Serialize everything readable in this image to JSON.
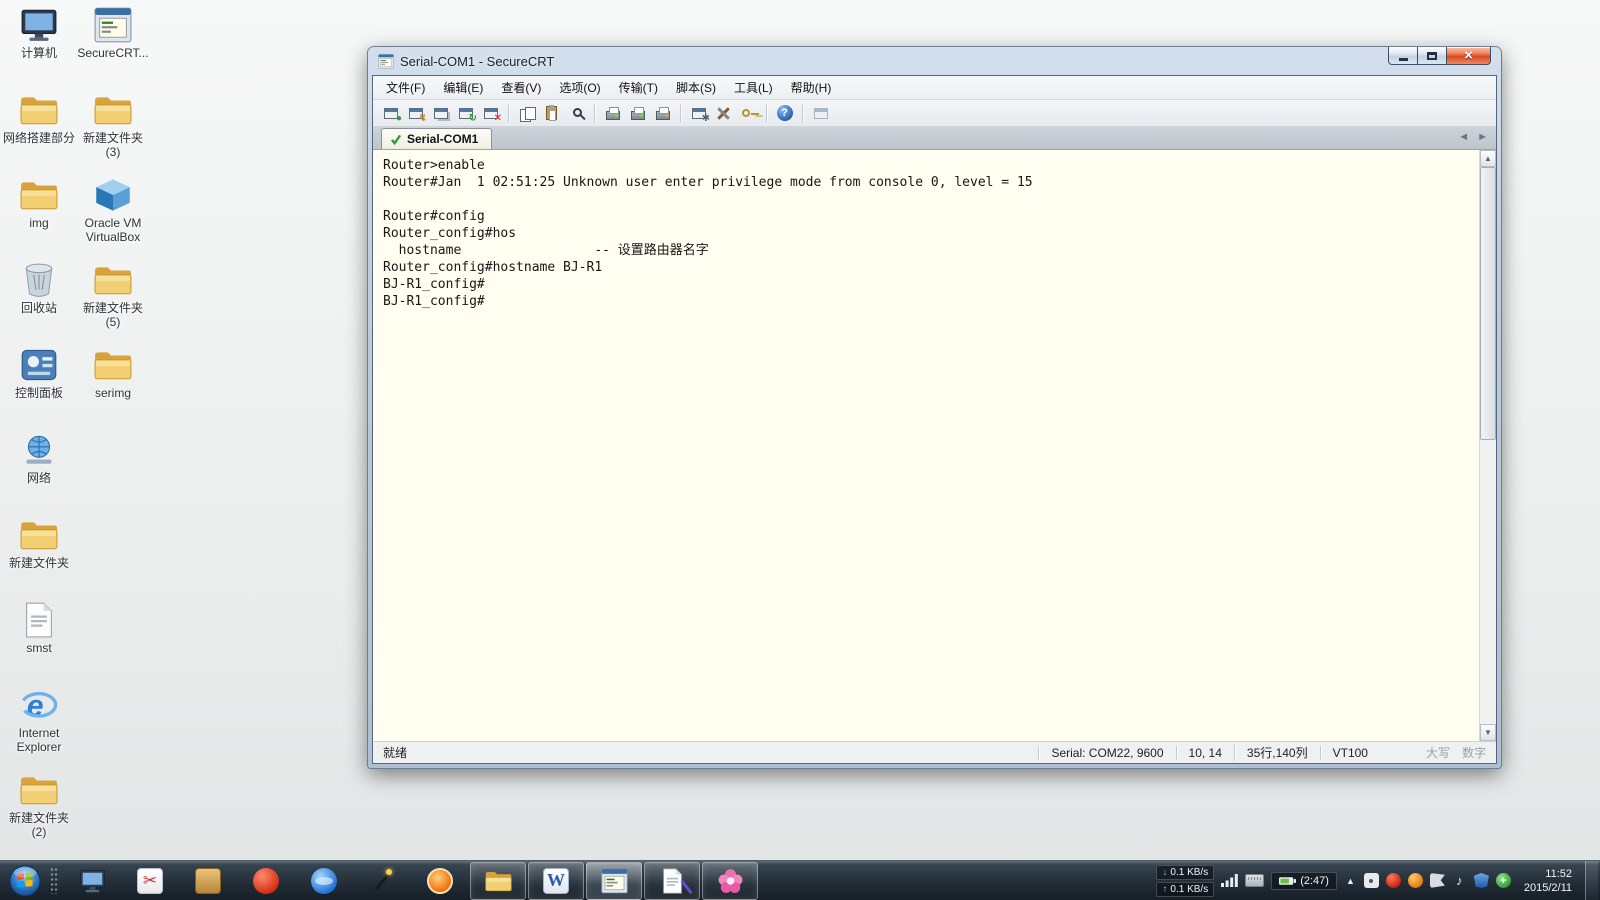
{
  "desktop": {
    "icons": [
      {
        "label": "计算机"
      },
      {
        "label": "网络搭建部分"
      },
      {
        "label": "img"
      },
      {
        "label": "回收站"
      },
      {
        "label": "控制面板"
      },
      {
        "label": "网络"
      },
      {
        "label": "新建文件夹"
      },
      {
        "label": "smst"
      },
      {
        "label": "Internet Explorer"
      },
      {
        "label": "新建文件夹 (2)"
      },
      {
        "label": "SecureCRT..."
      },
      {
        "label": "新建文件夹 (3)"
      },
      {
        "label": "Oracle VM VirtualBox"
      },
      {
        "label": "新建文件夹 (5)"
      },
      {
        "label": "serimg"
      }
    ]
  },
  "window": {
    "title": "Serial-COM1 - SecureCRT",
    "menus": [
      "文件(F)",
      "编辑(E)",
      "查看(V)",
      "选项(O)",
      "传输(T)",
      "脚本(S)",
      "工具(L)",
      "帮助(H)"
    ],
    "tab": {
      "label": "Serial-COM1"
    },
    "terminal": {
      "lines": [
        "Router>enable",
        "Router#Jan  1 02:51:25 Unknown user enter privilege mode from console 0, level = 15",
        "",
        "Router#config",
        "Router_config#hos",
        "  hostname                 -- 设置路由器名字",
        "Router_config#hostname BJ-R1",
        "BJ-R1_config#",
        "BJ-R1_config#"
      ]
    },
    "status": {
      "ready": "就绪",
      "serial": "Serial: COM22, 9600",
      "cursor": "10, 14",
      "size": "35行,140列",
      "emulation": "VT100",
      "caps": "大写",
      "num": "数字"
    }
  },
  "taskbar": {
    "tray": {
      "net_down": "0.1 KB/s",
      "net_up": "0.1 KB/s",
      "battery": "(2:47)",
      "time": "11:52",
      "date": "2015/2/11"
    }
  },
  "colors": {
    "terminal_bg": "#fffef0",
    "title_glass": "#c5d3e2",
    "close_red": "#d6481f",
    "taskbar_dark": "#232e38"
  }
}
